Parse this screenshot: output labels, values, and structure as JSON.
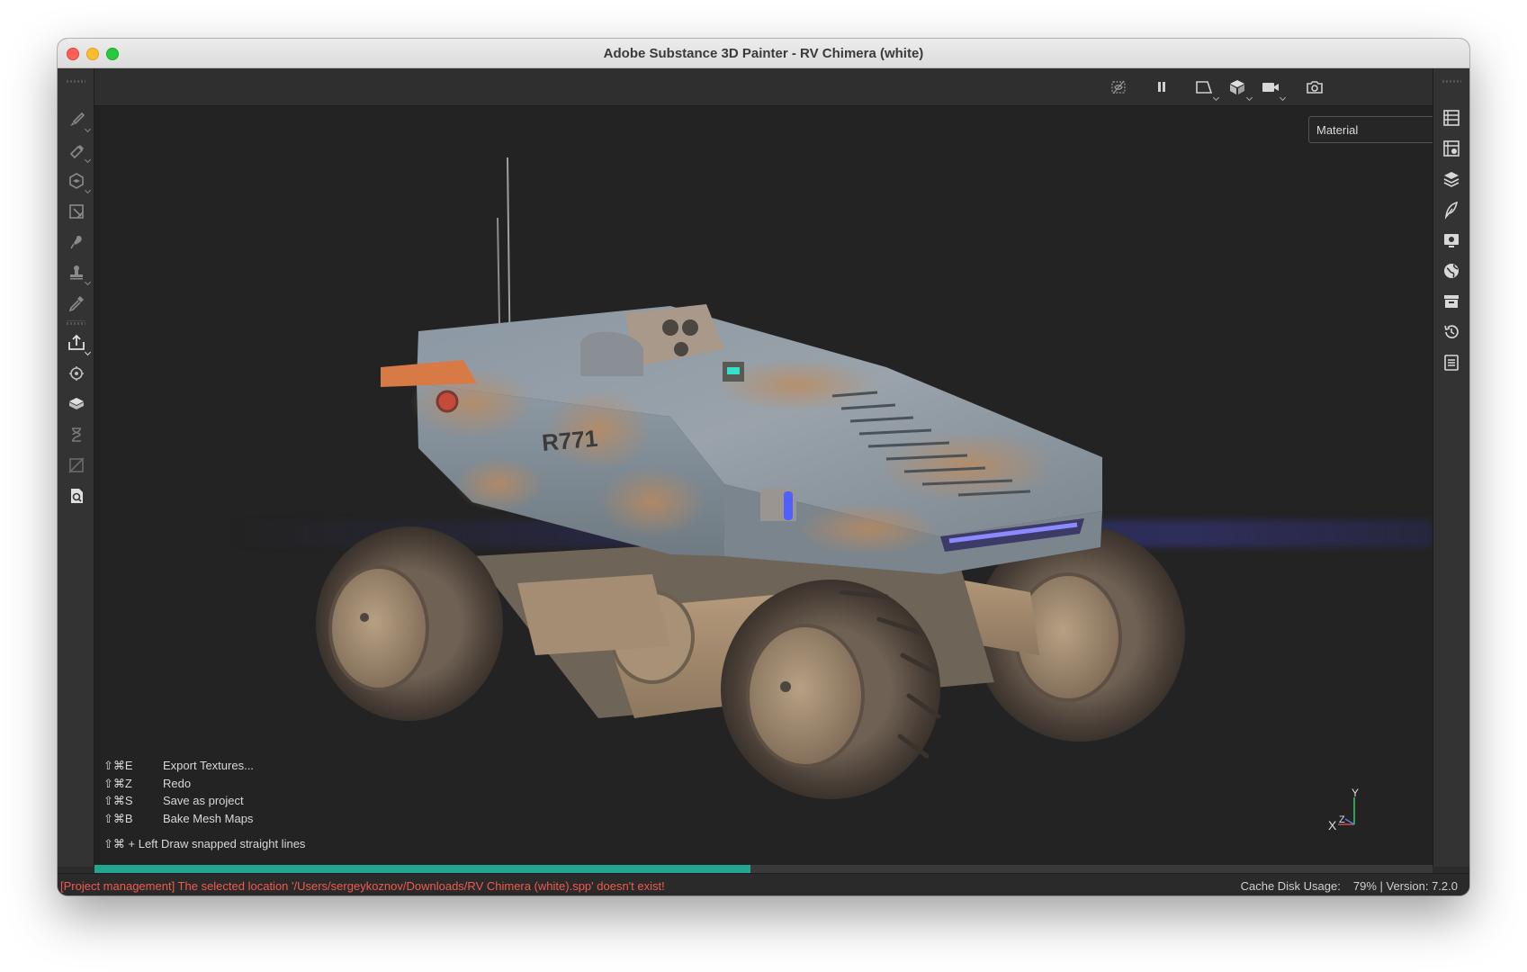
{
  "window": {
    "title": "Adobe Substance 3D Painter - RV Chimera (white)"
  },
  "left_toolbar": {
    "tools": [
      "paint-brush-icon",
      "eraser-icon",
      "projection-icon",
      "polygon-fill-icon",
      "smudge-icon",
      "clone-stamp-icon",
      "color-picker-icon",
      "export-icon",
      "bake-icon",
      "texture-set-icon",
      "history-icon",
      "uv-hide-icon",
      "document-icon"
    ]
  },
  "top_toolbar": {
    "buttons": [
      "hide-overlay-icon",
      "pause-icon",
      "view-mode-2d-icon",
      "view-mode-3d-icon",
      "camera-icon",
      "screenshot-icon"
    ]
  },
  "right_toolbar": {
    "panels": [
      "texture-set-list-icon",
      "texture-set-settings-icon",
      "layers-icon",
      "properties-icon",
      "display-settings-icon",
      "shelf-icon",
      "assets-icon",
      "history-icon",
      "log-icon"
    ]
  },
  "viewport": {
    "channel_select": "Material",
    "shortcuts": [
      {
        "key": "⇧⌘E",
        "label": "Export Textures..."
      },
      {
        "key": "⇧⌘Z",
        "label": "Redo"
      },
      {
        "key": "⇧⌘S",
        "label": "Save as project"
      },
      {
        "key": "⇧⌘B",
        "label": "Bake Mesh Maps"
      }
    ],
    "snap_hint": "⇧⌘ + Left  Draw snapped straight lines",
    "vehicle_marking": "R771",
    "axis": {
      "x": "X",
      "y": "Y",
      "z": "Z"
    }
  },
  "progress": {
    "value": 0.49,
    "color": "#23a58f"
  },
  "status_bar": {
    "message": "[Project management] The selected location '/Users/sergeykoznov/Downloads/RV Chimera (white).spp' doesn't exist!",
    "cache_label": "Cache Disk Usage:",
    "cache_value": "79% | Version: 7.2.0"
  },
  "colors": {
    "error": "#f05a4e",
    "accent": "#23a58f",
    "background": "#232323"
  }
}
